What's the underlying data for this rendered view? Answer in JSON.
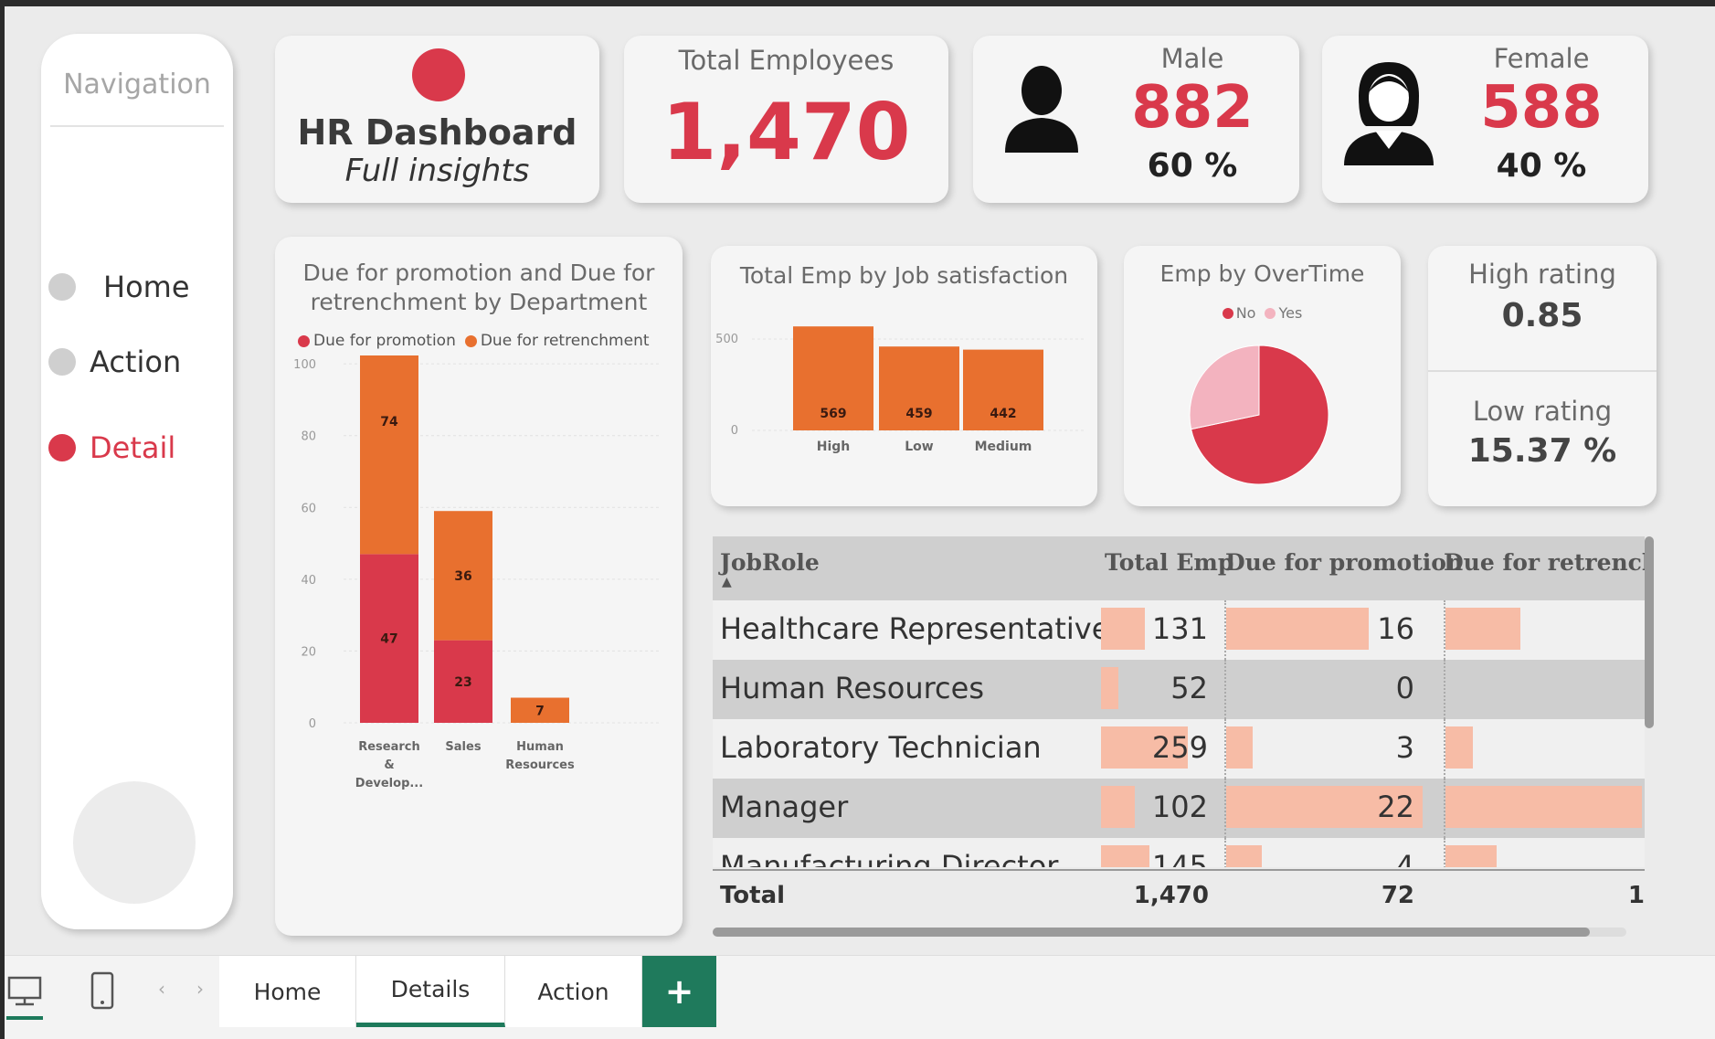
{
  "colors": {
    "accent": "#d9394b",
    "orange": "#e8702f",
    "pink_light": "#f7bca6",
    "teal": "#1f7a5c"
  },
  "nav": {
    "title": "Navigation",
    "items": [
      {
        "label": "Home",
        "active": false
      },
      {
        "label": "Action",
        "active": false
      },
      {
        "label": "Detail",
        "active": true
      }
    ]
  },
  "header": {
    "title": "HR Dashboard",
    "subtitle": "Full insights",
    "total_label": "Total Employees",
    "total_value": "1,470",
    "male_label": "Male",
    "male_value": "882",
    "male_pct": "60 %",
    "female_label": "Female",
    "female_value": "588",
    "female_pct": "40 %"
  },
  "ratings": {
    "high_label": "High rating",
    "high_value": "0.85",
    "low_label": "Low rating",
    "low_value": "15.37 %"
  },
  "chart_data": [
    {
      "type": "bar",
      "stacked": true,
      "title": "Due for promotion and Due for retrenchment by Department",
      "categories": [
        "Research & Develop...",
        "Sales",
        "Human Resources"
      ],
      "series": [
        {
          "name": "Due for promotion",
          "values": [
            47,
            23,
            0
          ],
          "color": "#d9394b"
        },
        {
          "name": "Due for retrenchment",
          "values": [
            74,
            36,
            7
          ],
          "color": "#e8702f"
        }
      ],
      "ylim": [
        0,
        140
      ],
      "yticks": [
        0,
        20,
        40,
        60,
        80,
        100,
        120,
        140
      ],
      "legend": "top"
    },
    {
      "type": "bar",
      "title": "Total Emp by Job satisfaction",
      "categories": [
        "High",
        "Low",
        "Medium"
      ],
      "values": [
        569,
        459,
        442
      ],
      "yticks": [
        0,
        500
      ],
      "ylim": [
        0,
        600
      ]
    },
    {
      "type": "pie",
      "title": "Emp by OverTime",
      "labels": [
        "No",
        "Yes"
      ],
      "values": [
        1054,
        416
      ],
      "colors": [
        "#d9394b",
        "#f3b3bf"
      ],
      "legend": "top"
    }
  ],
  "table": {
    "headers": [
      "JobRole",
      "Total Emp",
      "Due for promotion",
      "Due for retrenchm"
    ],
    "rows": [
      {
        "role": "Healthcare Representative",
        "total": "131",
        "promo": "16",
        "retrench_frac": 0.38
      },
      {
        "role": "Human Resources",
        "total": "52",
        "promo": "0",
        "retrench_frac": 0
      },
      {
        "role": "Laboratory Technician",
        "total": "259",
        "promo": "3",
        "retrench_frac": 0.14
      },
      {
        "role": "Manager",
        "total": "102",
        "promo": "22",
        "retrench_frac": 1.0
      },
      {
        "role": "Manufacturing Director",
        "total": "145",
        "promo": "4",
        "retrench_frac": 0.26
      }
    ],
    "total_label": "Total",
    "total_emp": "1,470",
    "total_promo": "72",
    "total_retrench": "1"
  },
  "tabs": [
    "Home",
    "Details",
    "Action"
  ],
  "tab_add": "+"
}
